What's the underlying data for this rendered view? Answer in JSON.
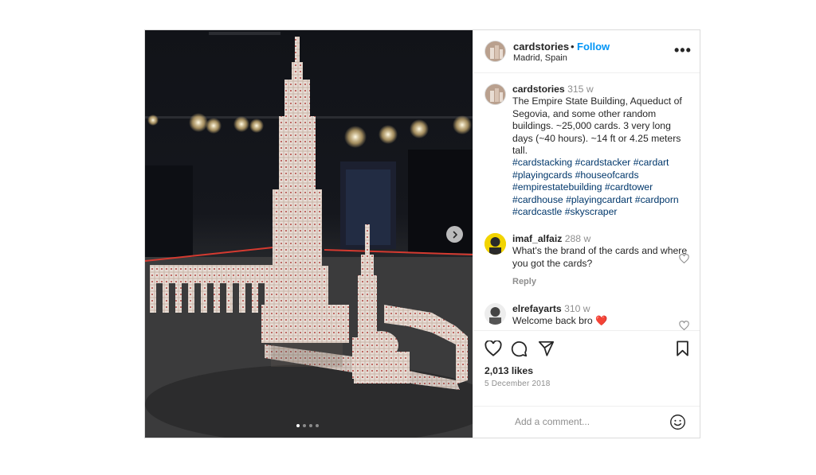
{
  "post": {
    "username": "cardstories",
    "follow_label": "Follow",
    "separator": "•",
    "location": "Madrid, Spain",
    "more_label": "•••",
    "caption": {
      "username": "cardstories",
      "time": "315 w",
      "text": "The Empire State Building, Aqueduct of Segovia, and some other random buildings. ~25,000 cards. 3 very long days (~40 hours). ~14 ft or 4.25 meters tall.",
      "hashtags": "#cardstacking #cardstacker #cardart #playingcards #houseofcards #empirestatebuilding #cardtower #cardhouse #playingcardart #cardporn #cardcastle #skyscraper"
    },
    "comments": [
      {
        "username": "imaf_alfaiz",
        "time": "288 w",
        "text": "What's the brand of the cards and where you got the cards?",
        "reply_label": "Reply"
      },
      {
        "username": "elrefayarts",
        "time": "310 w",
        "text": "Welcome back bro ❤️"
      }
    ],
    "likes": "2,013 likes",
    "date": "5 December 2018",
    "add_comment_placeholder": "Add a comment...",
    "carousel": {
      "slides": 4,
      "active_index": 0
    }
  },
  "icons": {
    "like": "heart-icon",
    "comment": "comment-bubble-icon",
    "share": "paper-plane-icon",
    "save": "bookmark-icon",
    "next": "chevron-right-icon",
    "emoji": "smiley-icon",
    "more": "ellipsis-icon"
  },
  "colors": {
    "follow_blue": "#0095f6",
    "hashtag_blue": "#00376b",
    "muted_text": "#8e8e8e",
    "border": "#dbdbdb",
    "heart_red": "#ed4956"
  }
}
